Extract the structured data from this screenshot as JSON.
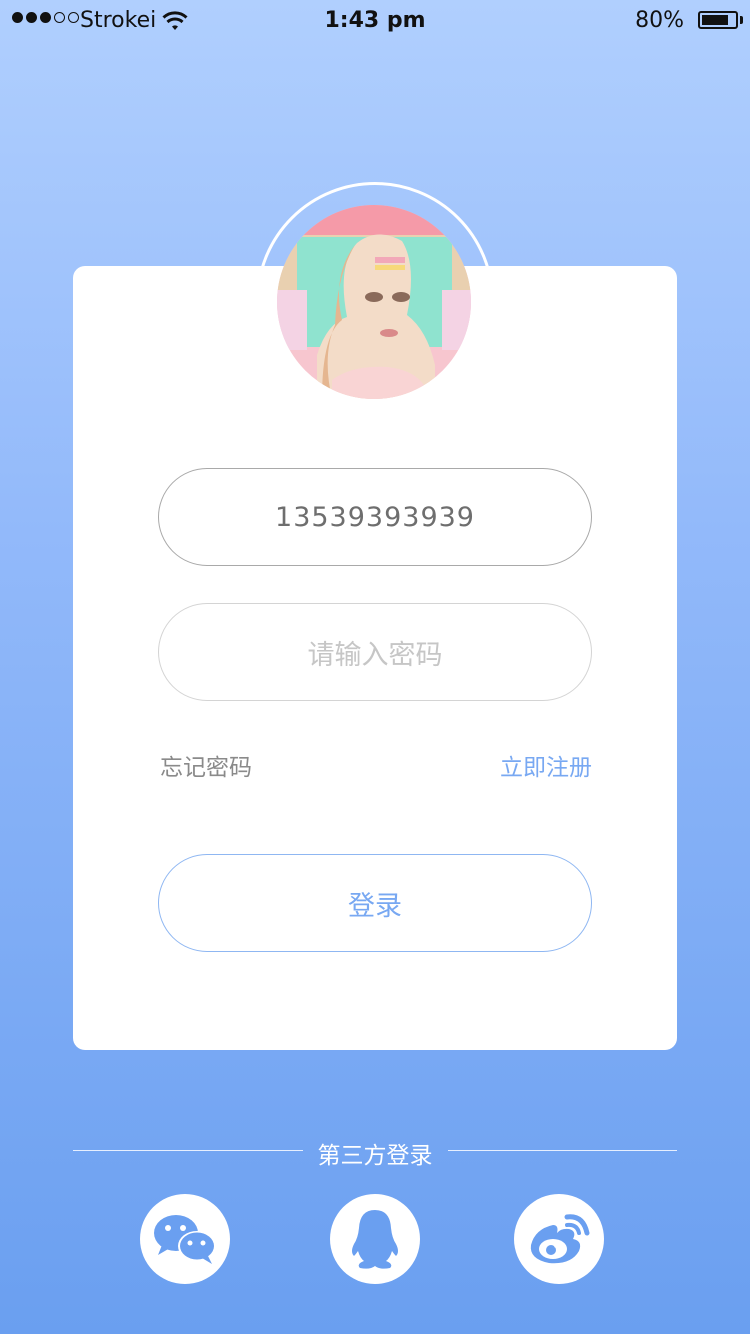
{
  "status_bar": {
    "carrier": "Strokei",
    "time": "1:43 pm",
    "battery": "80%",
    "battery_level": 0.8,
    "signal_bars_on": 3,
    "signal_bars_total": 5
  },
  "login": {
    "phone_value": "13539393939",
    "password_placeholder": "请输入密码",
    "forgot_label": "忘记密码",
    "register_label": "立即注册",
    "login_label": "登录"
  },
  "third_party": {
    "label": "第三方登录",
    "providers": [
      "wechat-icon",
      "qq-icon",
      "weibo-icon"
    ]
  },
  "colors": {
    "accent": "#78a8f2",
    "background_top": "#b0cffe",
    "background_bottom": "#6a9ff0"
  }
}
